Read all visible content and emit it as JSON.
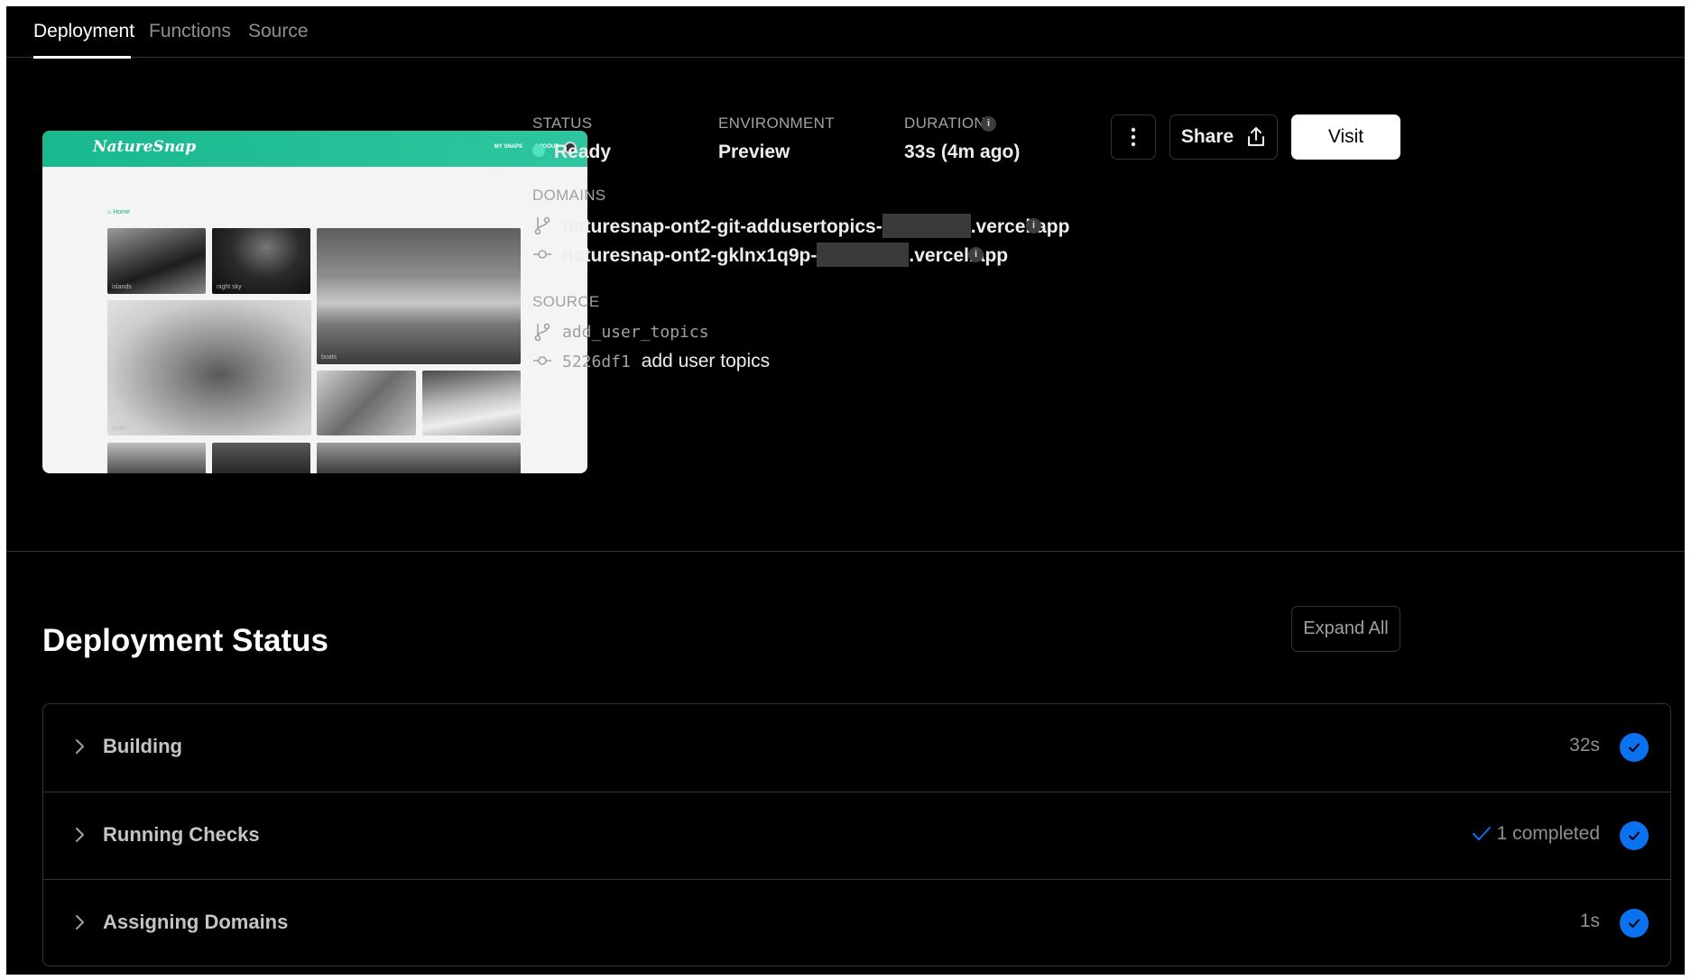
{
  "tabs": [
    {
      "label": "Deployment",
      "active": true
    },
    {
      "label": "Functions",
      "active": false
    },
    {
      "label": "Source",
      "active": false
    }
  ],
  "preview": {
    "logo": "NatureSnap",
    "nav": [
      "MY SNAPS",
      "LOGOUT"
    ],
    "breadcrumb": "Home",
    "captions": [
      "islands",
      "night sky",
      "boats",
      "wolfs"
    ]
  },
  "meta": {
    "status_label": "STATUS",
    "status_value": "Ready",
    "status_color": "#50e3c2",
    "environment_label": "ENVIRONMENT",
    "environment_value": "Preview",
    "duration_label": "DURATION",
    "duration_value": "33s (4m ago)"
  },
  "domains": {
    "label": "DOMAINS",
    "items": [
      {
        "prefix": "naturesnap-ont2-git-addusertopics-",
        "suffix": ".vercel.app",
        "icon": "git-branch-icon"
      },
      {
        "prefix": "naturesnap-ont2-gklnx1q9p-",
        "suffix": ".vercel.app",
        "icon": "git-commit-icon"
      }
    ]
  },
  "source": {
    "label": "SOURCE",
    "branch": "add_user_topics",
    "commit_hash": "5226df1",
    "commit_message": "add user topics"
  },
  "actions": {
    "share_label": "Share",
    "visit_label": "Visit"
  },
  "deployment_status": {
    "title": "Deployment Status",
    "expand_label": "Expand All",
    "steps": [
      {
        "title": "Building",
        "right": "32s",
        "check_text": false
      },
      {
        "title": "Running Checks",
        "right": "1 completed",
        "check_text": true
      },
      {
        "title": "Assigning Domains",
        "right": "1s",
        "check_text": false
      }
    ],
    "check_color": "#0a72ef"
  }
}
